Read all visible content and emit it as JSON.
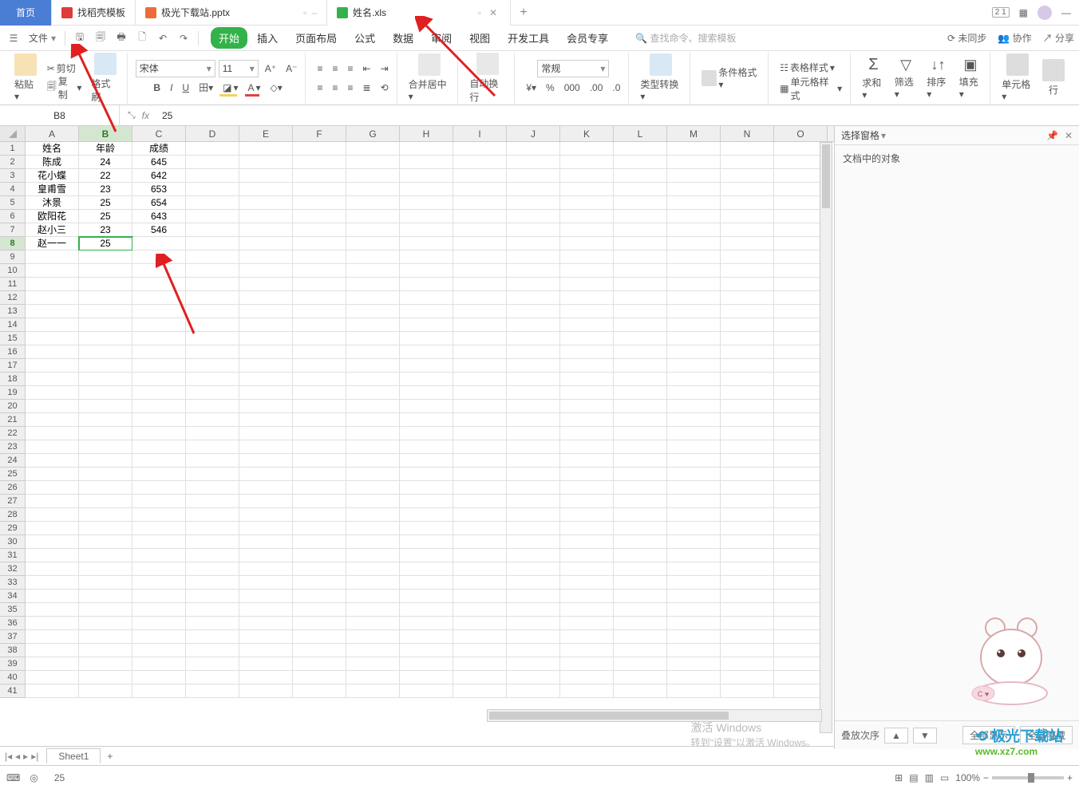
{
  "titlebar": {
    "home": "首页",
    "tabs": [
      {
        "label": "找稻壳模板",
        "color": "#e03a3a"
      },
      {
        "label": "极光下载站.pptx",
        "color": "#ef6a39"
      },
      {
        "label": "姓名.xls",
        "color": "#33b24a",
        "active": true
      }
    ]
  },
  "quickbar": {
    "file_label": "文件",
    "menus": [
      "开始",
      "插入",
      "页面布局",
      "公式",
      "数据",
      "审阅",
      "视图",
      "开发工具",
      "会员专享"
    ],
    "active_menu": 0,
    "search_placeholder": "查找命令、搜索模板",
    "right": [
      "未同步",
      "协作",
      "分享"
    ]
  },
  "ribbon": {
    "paste": "粘贴",
    "cut": "剪切",
    "copy": "复制",
    "format_painter": "格式刷",
    "font": "宋体",
    "font_size": "11",
    "merge": "合并居中",
    "wrap": "自动换行",
    "num_format": "常规",
    "type_convert": "类型转换",
    "cond_fmt": "条件格式",
    "table_style": "表格样式",
    "cell_style": "单元格样式",
    "sum": "求和",
    "filter": "筛选",
    "sort": "排序",
    "fill": "填充",
    "cell": "单元格",
    "row": "行"
  },
  "namebox": {
    "cell": "B8",
    "formula": "25"
  },
  "columns": [
    "A",
    "B",
    "C",
    "D",
    "E",
    "F",
    "G",
    "H",
    "I",
    "J",
    "K",
    "L",
    "M",
    "N",
    "O"
  ],
  "sel_col": 1,
  "sel_row": 8,
  "grid": [
    [
      "姓名",
      "年龄",
      "成绩",
      "",
      "",
      "",
      "",
      "",
      "",
      "",
      "",
      "",
      "",
      "",
      ""
    ],
    [
      "陈成",
      "24",
      "645",
      "",
      "",
      "",
      "",
      "",
      "",
      "",
      "",
      "",
      "",
      "",
      ""
    ],
    [
      "花小蝶",
      "22",
      "642",
      "",
      "",
      "",
      "",
      "",
      "",
      "",
      "",
      "",
      "",
      "",
      ""
    ],
    [
      "皇甫雪",
      "23",
      "653",
      "",
      "",
      "",
      "",
      "",
      "",
      "",
      "",
      "",
      "",
      "",
      ""
    ],
    [
      "沐景",
      "25",
      "654",
      "",
      "",
      "",
      "",
      "",
      "",
      "",
      "",
      "",
      "",
      "",
      ""
    ],
    [
      "欧阳花",
      "25",
      "643",
      "",
      "",
      "",
      "",
      "",
      "",
      "",
      "",
      "",
      "",
      "",
      ""
    ],
    [
      "赵小三",
      "23",
      "546",
      "",
      "",
      "",
      "",
      "",
      "",
      "",
      "",
      "",
      "",
      "",
      ""
    ],
    [
      "赵一一",
      "25",
      "",
      "",
      "",
      "",
      "",
      "",
      "",
      "",
      "",
      "",
      "",
      "",
      ""
    ]
  ],
  "total_rows": 41,
  "panel": {
    "title": "选择窗格",
    "subtitle": "文档中的对象",
    "stack": "叠放次序",
    "show_all": "全部显示",
    "hide_all": "全部隐藏"
  },
  "sheet": {
    "name": "Sheet1"
  },
  "statusbar": {
    "left_value": "25",
    "zoom": "100%",
    "activate": "激活 Windows",
    "activate2": "转到\"设置\"以激活 Windows。",
    "watermark": "极光下载站",
    "watermark2": "www.xz7.com"
  }
}
